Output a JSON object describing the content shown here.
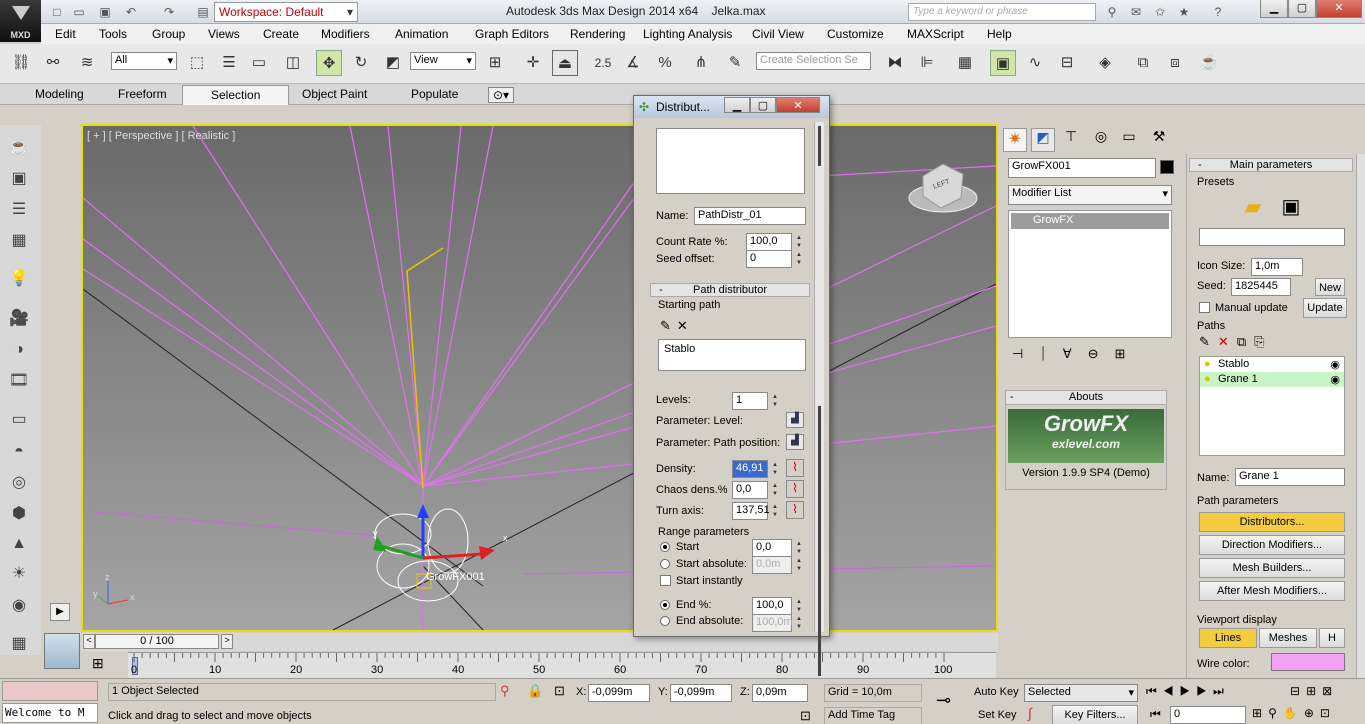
{
  "app": {
    "logo": "MXD",
    "title": "Autodesk 3ds Max Design 2014 x64",
    "file": "Jelka.max",
    "workspace": "Workspace: Default",
    "search_placeholder": "Type a keyword or phrase"
  },
  "menu": [
    "Edit",
    "Tools",
    "Group",
    "Views",
    "Create",
    "Modifiers",
    "Animation",
    "Graph Editors",
    "Rendering",
    "Lighting Analysis",
    "Civil View",
    "Customize",
    "MAXScript",
    "Help"
  ],
  "toolbar": {
    "selection_filter": "All",
    "ref_coord": "View",
    "snap_value": "2.5",
    "angle_value": "%",
    "create_selection_set": "Create Selection Se"
  },
  "ribbon_tabs": [
    "Modeling",
    "Freeform",
    "Selection",
    "Object Paint",
    "Populate"
  ],
  "viewport": {
    "label": "[ + ] [ Perspective ] [ Realistic ]",
    "object_label": "GrowFX001",
    "axis_x": "x",
    "axis_y": "y",
    "axis_z": "z",
    "cube_label": "LEFT"
  },
  "timeline": {
    "frame": "0 / 100",
    "ticks": [
      "0",
      "10",
      "20",
      "30",
      "40",
      "50",
      "60",
      "70",
      "80",
      "90",
      "100"
    ]
  },
  "status": {
    "listener": "Welcome to M",
    "selected": "1 Object Selected",
    "hint": "Click and drag to select and move objects",
    "x_label": "X:",
    "x": "-0,099m",
    "y_label": "Y:",
    "y": "-0,099m",
    "z_label": "Z:",
    "z": "0,09m",
    "grid": "Grid = 10,0m",
    "add_time_tag": "Add Time Tag",
    "auto_key": "Auto Key",
    "set_key": "Set Key",
    "key_mode": "Selected",
    "key_filters": "Key Filters...",
    "frame_field": "0"
  },
  "dialog": {
    "title": "Distribut...",
    "name_label": "Name:",
    "name_value": "PathDistr_01",
    "count_rate_label": "Count Rate %:",
    "count_rate": "100,0",
    "seed_offset_label": "Seed offset:",
    "seed_offset": "0",
    "section_path": "Path distributor",
    "starting_path": "Starting path",
    "path_item": "Stablo",
    "levels_label": "Levels:",
    "levels": "1",
    "param_level": "Parameter: Level:",
    "param_path_pos": "Parameter: Path position:",
    "density_label": "Density:",
    "density": "46,91",
    "chaos_label": "Chaos dens.%",
    "chaos": "0,0",
    "turn_label": "Turn axis:",
    "turn": "137,51",
    "range_params": "Range parameters",
    "start_label": "Start",
    "start_value": "0,0",
    "start_abs_label": "Start absolute:",
    "start_abs_value": "0,0m",
    "start_instantly": "Start instantly",
    "end_label": "End %:",
    "end_value": "100,0",
    "end_abs_label": "End absolute:",
    "end_abs_value": "100,0m"
  },
  "command_panel": {
    "object_name": "GrowFX001",
    "modifier_list": "Modifier List",
    "stack_item": "GrowFX",
    "abouts_header": "Abouts",
    "logo_main": "GrowFX",
    "logo_sub": "exlevel.com",
    "version": "Version 1.9.9 SP4 (Demo)"
  },
  "growfx": {
    "main_params": "Main parameters",
    "presets": "Presets",
    "icon_size_label": "Icon Size:",
    "icon_size": "1,0m",
    "seed_label": "Seed:",
    "seed": "1825445",
    "new_btn": "New",
    "manual_update": "Manual update",
    "update_btn": "Update",
    "paths_label": "Paths",
    "paths": [
      "Stablo",
      "Grane 1"
    ],
    "name_label": "Name:",
    "name_value": "Grane 1",
    "path_params": "Path parameters",
    "distributors": "Distributors...",
    "direction_mod": "Direction Modifiers...",
    "mesh_builders": "Mesh Builders...",
    "after_mesh": "After Mesh Modifiers...",
    "viewport_display": "Viewport display",
    "lines_btn": "Lines",
    "meshes_btn": "Meshes",
    "h_btn": "H",
    "wire_color": "Wire color:",
    "wire_color_hex": "#f4a0f4",
    "highlight_hex": "#f4cc40"
  }
}
